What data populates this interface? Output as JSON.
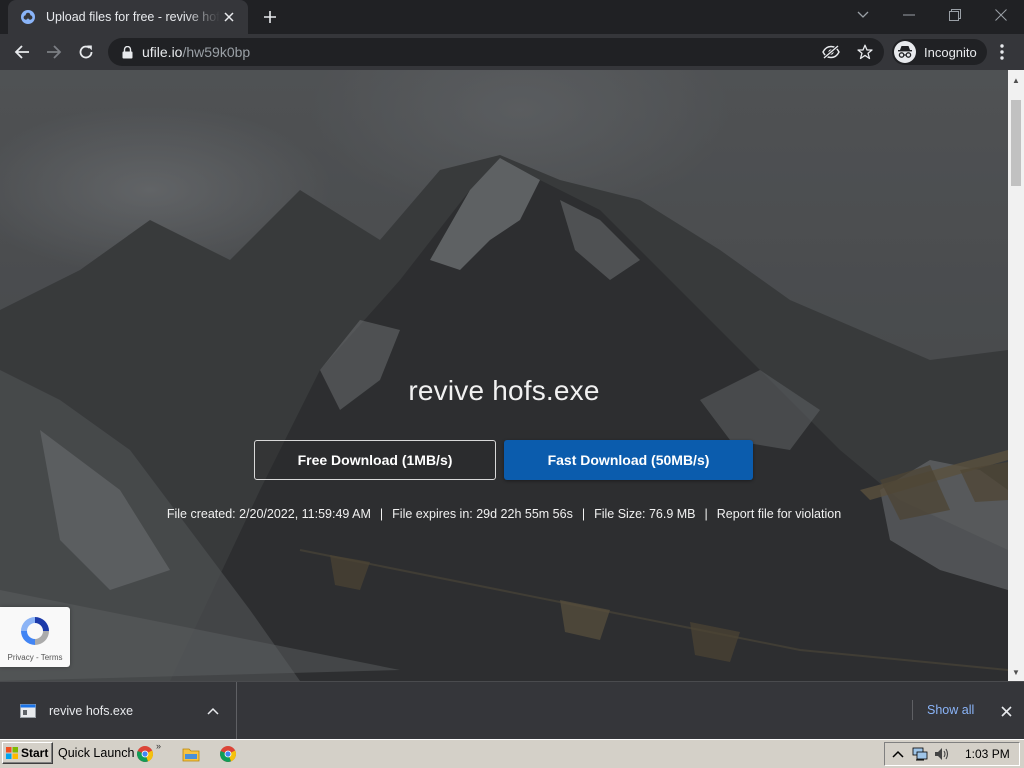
{
  "browser": {
    "tab": {
      "title": "Upload files for free - revive hofs.exe"
    },
    "url": {
      "domain": "ufile.io",
      "path": "/hw59k0bp"
    },
    "profile_label": "Incognito"
  },
  "page": {
    "file_name": "revive hofs.exe",
    "free_download_label": "Free Download (1MB/s)",
    "fast_download_label": "Fast Download (50MB/s)",
    "meta": {
      "created": "File created: 2/20/2022, 11:59:49 AM",
      "expires": "File expires in: 29d 22h 55m 56s",
      "size": "File Size: 76.9 MB",
      "report": "Report file for violation",
      "separator": "|"
    },
    "recaptcha": {
      "links": "Privacy - Terms"
    }
  },
  "downloads": {
    "item_name": "revive hofs.exe",
    "show_all_label": "Show all"
  },
  "taskbar": {
    "start_label": "Start",
    "quick_launch_label": "Quick Launch",
    "more_label": "»",
    "clock": "1:03 PM"
  },
  "colors": {
    "chrome_dark": "#202124",
    "chrome_toolbar": "#35363a",
    "fast_button": "#0b5cad",
    "link_blue": "#8ab4f8",
    "taskbar": "#d4d0c8"
  }
}
